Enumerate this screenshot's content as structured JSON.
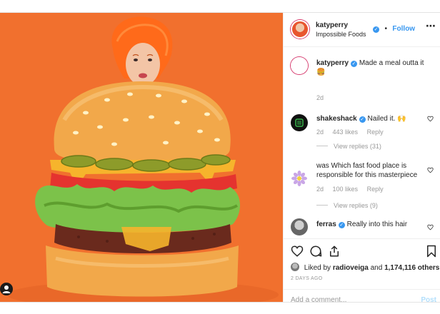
{
  "post": {
    "header": {
      "username": "katyperry",
      "separator": "•",
      "follow_label": "Follow",
      "subtitle": "Impossible Foods",
      "more_icon": "more-options-icon"
    },
    "caption": {
      "username": "katyperry",
      "text": "Made a meal outta it 🍔",
      "time": "2d"
    },
    "comments": [
      {
        "username": "shakeshack",
        "verified": true,
        "text": "Nailed it. 🙌",
        "time": "2d",
        "likes": "443 likes",
        "reply_label": "Reply",
        "view_replies": "View replies (31)"
      },
      {
        "username": "",
        "verified": false,
        "text": "was Which fast food place is responsible for this masterpiece",
        "time": "2d",
        "likes": "100 likes",
        "reply_label": "Reply",
        "view_replies": "View replies (9)"
      },
      {
        "username": "ferras",
        "verified": true,
        "text": "Really into this hair"
      }
    ],
    "actions": {
      "like_icon": "heart-icon",
      "comment_icon": "comment-icon",
      "share_icon": "share-icon",
      "save_icon": "bookmark-icon"
    },
    "likes": {
      "prefix": "Liked by",
      "liker": "radioveiga",
      "middle": "and",
      "count": "1,174,116 others"
    },
    "date": "2 DAYS AGO",
    "add_comment": {
      "placeholder": "Add a comment...",
      "post_label": "Post"
    }
  },
  "colors": {
    "accent_blue": "#3897f0",
    "photo_background": "#f06b2d",
    "muted_text": "#999999"
  }
}
